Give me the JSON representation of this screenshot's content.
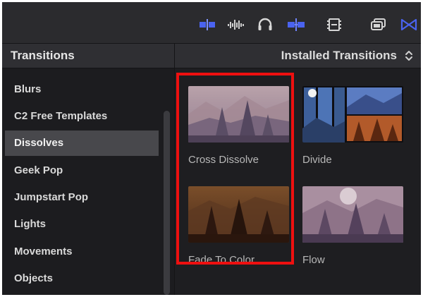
{
  "sidebar": {
    "title": "Transitions",
    "items": [
      {
        "label": "Blurs",
        "selected": false
      },
      {
        "label": "C2 Free Templates",
        "selected": false
      },
      {
        "label": "Dissolves",
        "selected": true
      },
      {
        "label": "Geek Pop",
        "selected": false
      },
      {
        "label": "Jumpstart Pop",
        "selected": false
      },
      {
        "label": "Lights",
        "selected": false
      },
      {
        "label": "Movements",
        "selected": false
      },
      {
        "label": "Objects",
        "selected": false
      }
    ]
  },
  "browser": {
    "title": "Installed Transitions",
    "tiles": [
      {
        "label": "Cross Dissolve",
        "icon": "cross-dissolve-thumbnail"
      },
      {
        "label": "Divide",
        "icon": "divide-thumbnail"
      },
      {
        "label": "Fade To Color",
        "icon": "fade-to-color-thumbnail"
      },
      {
        "label": "Flow",
        "icon": "flow-thumbnail"
      }
    ]
  },
  "toolbar": {
    "icons": [
      "clip-appearance-icon",
      "audio-waveform-icon",
      "headphones-icon",
      "snapping-icon",
      "filmstrip-icon",
      "window-layout-icon",
      "transitions-browser-icon"
    ]
  },
  "colors": {
    "accent": "#4a63f0",
    "highlight": "#ee1010",
    "selected_row": "#48484c"
  }
}
